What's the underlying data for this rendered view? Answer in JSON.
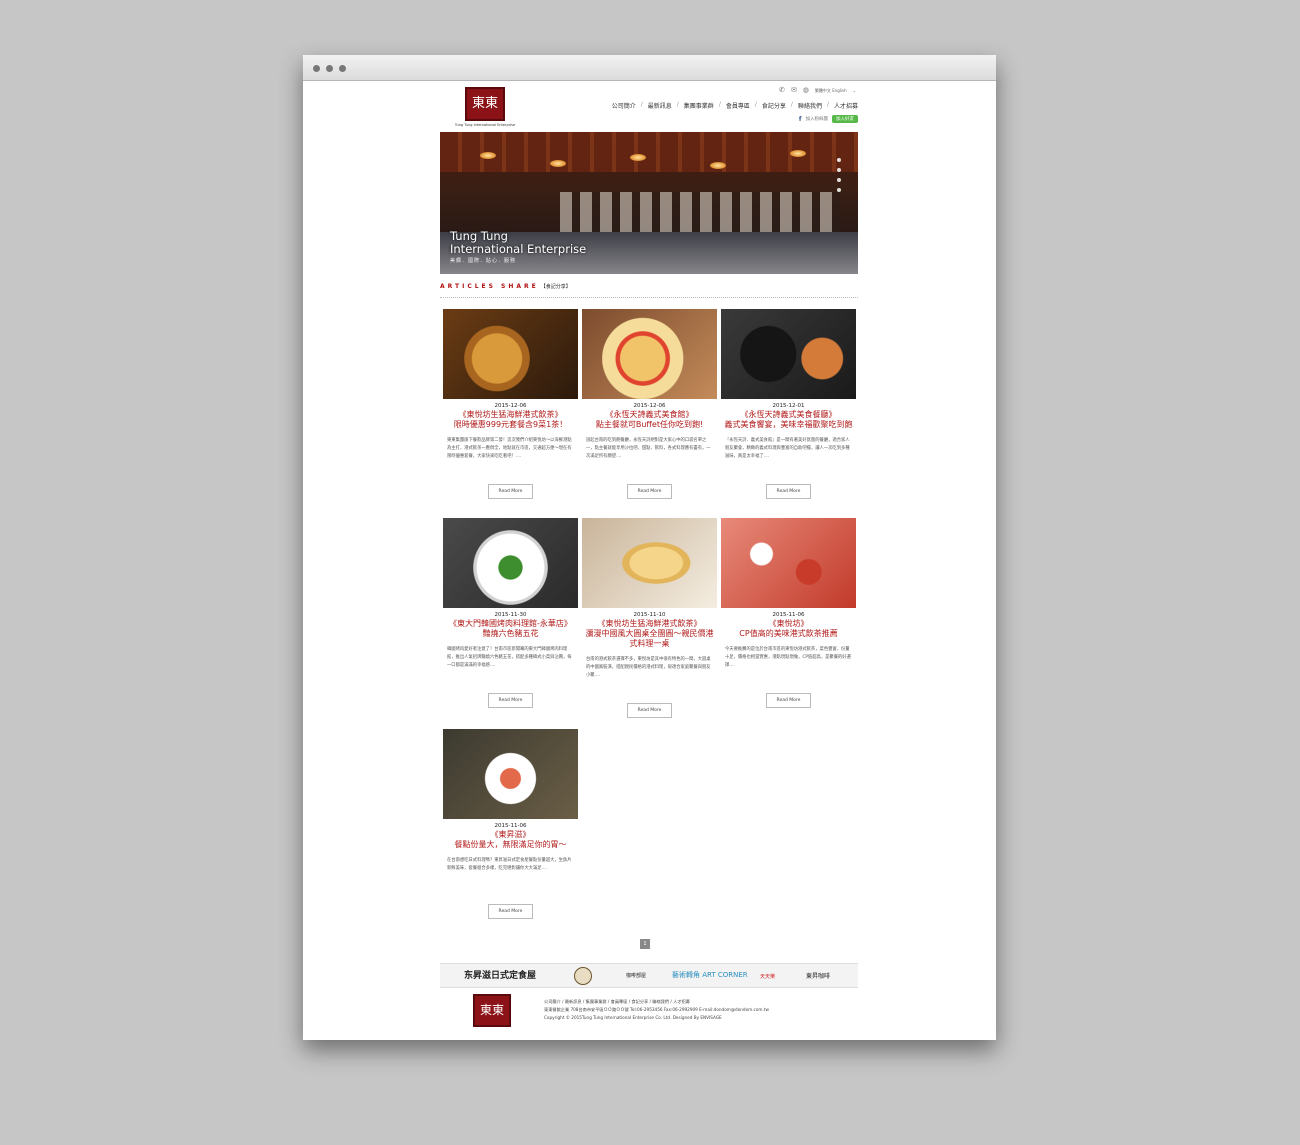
{
  "logo": {
    "text": "東東",
    "caption": "Tung Tung International Enterprise"
  },
  "util": {
    "language": "繁體中文 English"
  },
  "nav": [
    "公司簡介",
    "最新訊息",
    "集團事業群",
    "會員專區",
    "食記分享",
    "聯絡我們",
    "人才招募"
  ],
  "social": {
    "facebook": "加入粉絲團",
    "line": "加入好友"
  },
  "banner": {
    "title_line1": "Tung Tung",
    "title_line2": "International Enterprise",
    "subtitle": "美饌．國際．貼心．服務"
  },
  "section": {
    "title_en": "ARTICLES SHARE",
    "title_zh": "【食記分享】"
  },
  "read_more": "Read More",
  "articles": [
    {
      "date": "2015-12-06",
      "title1": "《東悅坊生猛海鮮港式飲茶》",
      "title2": "限時優惠999元套餐含9菜1茶！",
      "excerpt": "東東集團旗下餐飲品牌第二發！這次我們介紹東悅坊～以海鮮港點為主打，港式飲茶一應俱全，地點就在市區，交通超方便～現在有限時優惠套餐，大家快來吃吃看吧！...."
    },
    {
      "date": "2015-12-06",
      "title1": "《永恆天詩義式美食館》",
      "title2": "點主餐就可Buffet任你吃到飽!",
      "excerpt": "說起台南的吃到飽餐廳，永恆天詩絕對是大家心中的口袋名單之一，點主餐就能享用沙拉吧、甜點、飲料，各式料理應有盡有，一次滿足所有願望...."
    },
    {
      "date": "2015-12-01",
      "title1": "《永恆天詩義式美食餐廳》",
      "title2": "義式美食饗宴，美味幸福歡聚吃到飽",
      "excerpt": "『永恆天詩．義式美食館』是一間有著美好氛圍的餐廳，適合家人朋友聚會，精緻的義式料理與豐富的自助吧檯，讓人一次吃到多種滋味，真是太幸福了...."
    },
    {
      "date": "2015-11-30",
      "title1": "《東大門韓國烤肉料理館-永華店》",
      "title2": "豔燒六色豬五花",
      "excerpt": "韓國烤肉愛好者注意了！台南市區新開幕的東大門韓國烤肉料理館，推出人氣招牌豔燒六色豬五花，搭配多種韓式小菜與沾醬，每一口都是滿滿的幸福感...."
    },
    {
      "date": "2015-11-10",
      "title1": "《東悅坊生猛海鮮港式飲茶》",
      "title2": "瀰漫中國風大圓桌全團圓～親民價港式料理一桌",
      "excerpt": "台南的港式飲茶選擇不多，東悅坊是其中很有特色的一間，大圓桌的中國風裝潢，搭配親民價格的港式料理，很適合家庭聚餐與朋友小聚...."
    },
    {
      "date": "2015-11-06",
      "title1": "《東悅坊》",
      "title2": "CP值高的美味港式飲茶推薦",
      "excerpt": "今天要推薦的是位於台南市區的東悅坊港式飲茶，菜色豐富、份量十足，價格也相當實惠，港點現點現做，CP值超高，是聚餐的好選擇...."
    },
    {
      "date": "2015-11-06",
      "title1": "《東昇滋》",
      "title2": "餐點份量大，無限滿足你的胃～",
      "excerpt": "在台南想吃日式料理嗎？東昇滋日式定食屋餐點份量超大，生魚片新鮮美味，套餐組合多樣，吃完絕對讓你大大滿足...."
    }
  ],
  "pagination": {
    "current": "1"
  },
  "partners": [
    "东昇滋日式定食屋",
    "咖啡部屋",
    "藝術轉角 ART CORNER",
    "天天樂",
    "東昇咖啡"
  ],
  "footer": {
    "links": "公司簡介 / 最新訊息 / 集團事業群 / 會員專區 / 食記分享 / 聯絡我們 / 人才招募",
    "address": "東東餐飲企業 708台南市安平區ＯＯ路ＯＯ號 Tel:06-2953456 Fax:06-2992909 E-mail:dondom@dondom.com.tw",
    "copyright": "Copyright © 2015Tung Tung International Enterprise Co. Ltd. Designed By ENVISAGE"
  },
  "colors": {
    "brand": "#8b1217",
    "title": "#b11a1a"
  }
}
